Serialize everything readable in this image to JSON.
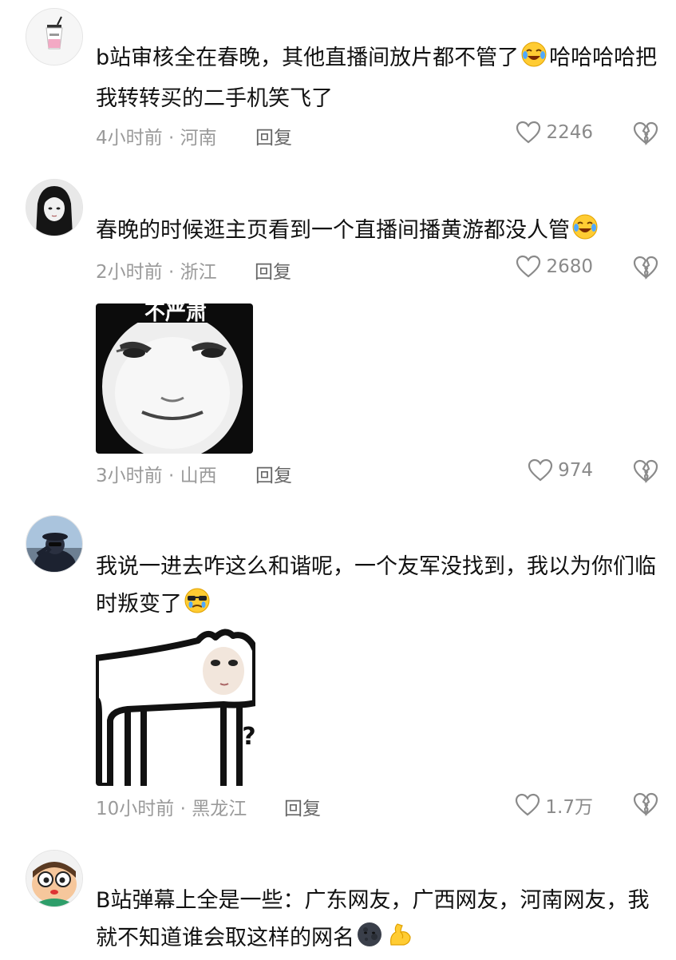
{
  "comments": [
    {
      "username": "",
      "text_before_emoji": "b站审核全在春晚，其他直播间放片都不管了",
      "text_after_emoji": "哈哈哈哈把我转转买的二手机笑飞了",
      "emoji": "laughing-crying-emoji",
      "time_location": "4小时前 · 河南",
      "reply_label": "回复",
      "likes": "2246"
    },
    {
      "username": "",
      "text_before_emoji": "春晚的时候逛主页看到一个直播间播黄游都没人管",
      "text_after_emoji": "",
      "emoji": "laughing-crying-emoji",
      "time_location": "2小时前 · 浙江",
      "reply_label": "回复",
      "likes": "2680"
    },
    {
      "username": "",
      "sticker": "pale-face-meme-sticker",
      "sticker_caption": "不严肃",
      "time_location": "3小时前 · 山西",
      "reply_label": "回复",
      "likes": "974"
    },
    {
      "username": "",
      "text_before_emoji": "我说一进去咋这么和谐呢，一个友军没找到，我以为你们临时叛变了",
      "text_after_emoji": "",
      "emoji": "sunglasses-crying-emoji",
      "sticker": "long-dog-meme-sticker",
      "sticker_caption": "?",
      "time_location": "10小时前 · 黑龙江",
      "reply_label": "回复",
      "likes": "1.7万"
    },
    {
      "username": "",
      "text_before_emoji": "B站弹幕上全是一些：广东网友，广西网友，河南网友，我就不知道谁会取这样的网名",
      "text_after_emoji": "",
      "emoji": "new-moon-face-emoji",
      "emoji2": "flexed-biceps-emoji"
    }
  ],
  "colors": {
    "text": "#111111",
    "meta": "#9a9a9a",
    "reply": "#666666",
    "icon": "#8a8a8a",
    "background": "#ffffff"
  },
  "icons": {
    "like": "heart-outline-icon",
    "dislike": "broken-heart-icon"
  }
}
